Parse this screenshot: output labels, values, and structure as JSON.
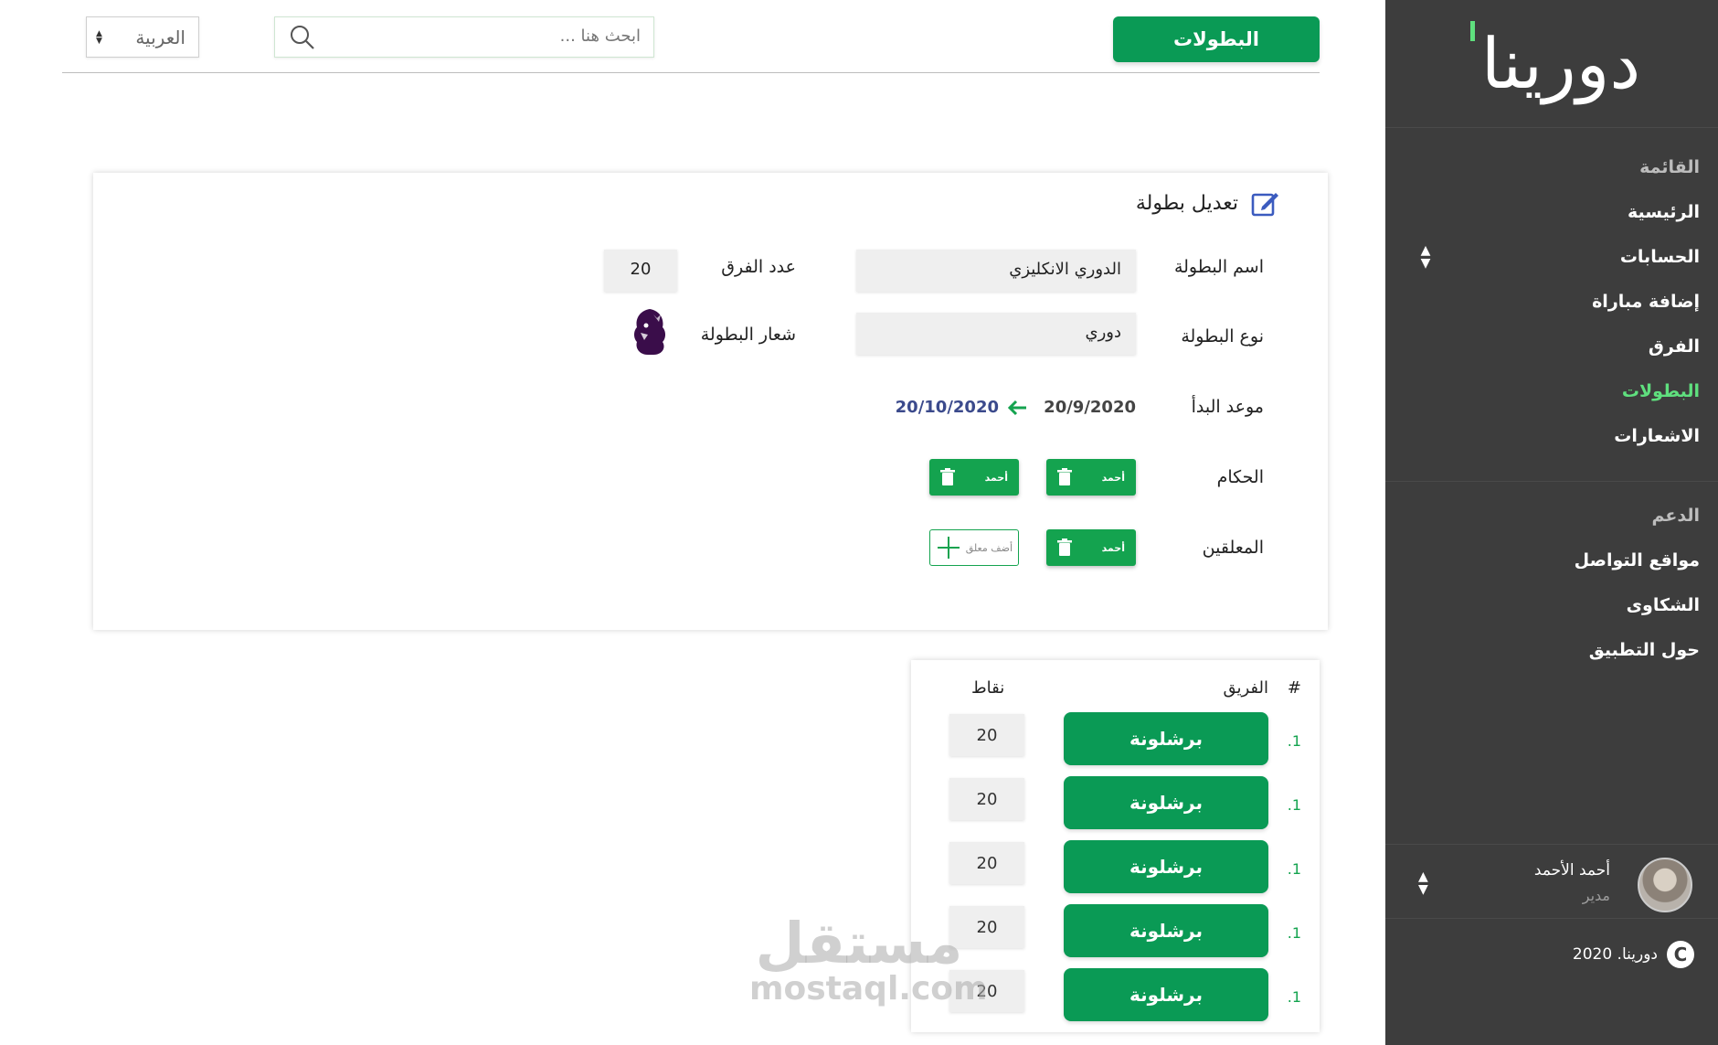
{
  "brand": {
    "logo_text": "دورينا"
  },
  "sidebar": {
    "menu_header": "القائمة",
    "menu_items": [
      "الرئيسية",
      "الحسابات",
      "إضافة مباراة",
      "الفرق",
      "البطولات",
      "الاشعارات"
    ],
    "active_item": "البطولات",
    "support_header": "الدعم",
    "support_items": [
      "مواقع التواصل",
      "الشكاوى",
      "حول التطبيق"
    ],
    "user": {
      "name": "أحمد الأحمد",
      "role": "مدير"
    },
    "copyright": "دورينا. 2020"
  },
  "topbar": {
    "primary_button": "البطولات",
    "search": {
      "placeholder": "ابحث هنا ..."
    },
    "language": {
      "selected": "العربية"
    }
  },
  "edit_card": {
    "title": "تعديل بطولة",
    "league_name_label": "اسم البطولة",
    "league_name_value": "الدوري الانكليزي",
    "teams_count_label": "عدد الفرق",
    "teams_count_value": "20",
    "league_type_label": "نوع البطولة",
    "league_type_value": "دوري",
    "logo_label": "شعار البطولة",
    "start_label": "موعد البدأ",
    "start_date": "20/9/2020",
    "end_date": "20/10/2020",
    "referees_label": "الحكام",
    "referees": [
      "أحمد",
      "أحمد"
    ],
    "commentators_label": "المعلقين",
    "commentators": [
      "أحمد"
    ],
    "add_commentator_label": "أضف معلق"
  },
  "standings": {
    "headers": {
      "rank": "#",
      "team": "الفريق",
      "points": "نقاط"
    },
    "rows": [
      {
        "rank": ".1",
        "team": "برشلونة",
        "points": "20"
      },
      {
        "rank": ".1",
        "team": "برشلونة",
        "points": "20"
      },
      {
        "rank": ".1",
        "team": "برشلونة",
        "points": "20"
      },
      {
        "rank": ".1",
        "team": "برشلونة",
        "points": "20"
      },
      {
        "rank": ".1",
        "team": "برشلونة",
        "points": "20"
      }
    ]
  },
  "watermark": {
    "arabic": "مستقل",
    "latin": "mostaql.com"
  },
  "colors": {
    "primary_green": "#0a9a55",
    "active_green": "#5fe07e",
    "sidebar_bg": "#3d3d3d",
    "date_blue": "#3b4a8c"
  }
}
